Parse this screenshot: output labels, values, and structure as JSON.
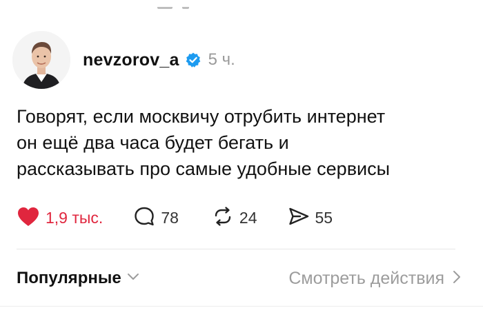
{
  "post": {
    "username": "nevzorov_a",
    "timestamp": "5 ч.",
    "verified": true,
    "text_lines": [
      "Говорят, если москвичу отрубить интернет",
      "он ещё два часа будет бегать и",
      "рассказывать про самые удобные сервисы"
    ]
  },
  "actions": {
    "likes": "1,9 тыс.",
    "comments": "78",
    "reposts": "24",
    "shares": "55"
  },
  "footer": {
    "sort_label": "Популярные",
    "view_activity_label": "Смотреть действия"
  },
  "colors": {
    "like": "#e0263e",
    "verified": "#1d9bf0",
    "muted_text": "#9c9c9c"
  },
  "icons": {
    "like": "heart-icon",
    "comment": "speech-bubble-icon",
    "repost": "repost-arrows-icon",
    "share": "send-icon",
    "sort": "chevron-down-icon",
    "view": "chevron-right-icon",
    "verified": "verified-badge-icon"
  }
}
